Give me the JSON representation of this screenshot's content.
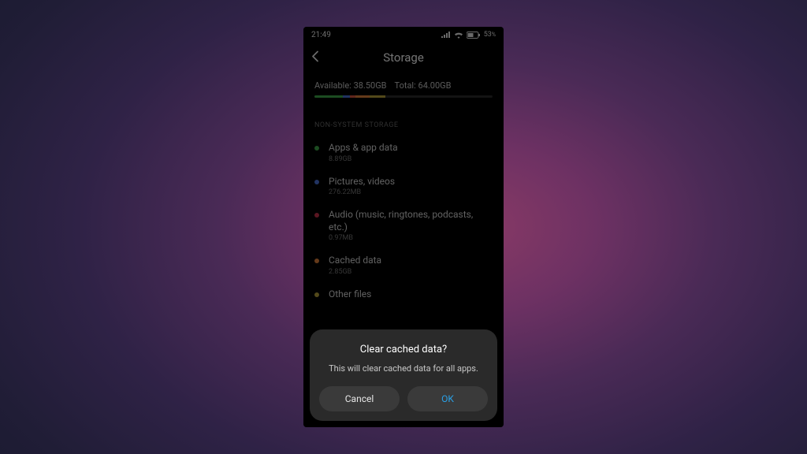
{
  "status": {
    "time": "21:49",
    "battery_text": "53"
  },
  "header": {
    "title": "Storage"
  },
  "summary": {
    "available_label": "Available:",
    "available_value": "38.50GB",
    "total_label": "Total:",
    "total_value": "64.00GB",
    "segments": [
      {
        "color": "#3fa84a",
        "pct": 16
      },
      {
        "color": "#4a72d8",
        "pct": 4
      },
      {
        "color": "#d8563f",
        "pct": 3
      },
      {
        "color": "#e0823a",
        "pct": 8
      },
      {
        "color": "#b8a23a",
        "pct": 9
      }
    ]
  },
  "section_label": "NON-SYSTEM STORAGE",
  "items": [
    {
      "dot": "#3fa84a",
      "title": "Apps & app data",
      "sub": "8.89GB"
    },
    {
      "dot": "#4a72d8",
      "title": "Pictures, videos",
      "sub": "276.22MB"
    },
    {
      "dot": "#c8324a",
      "title": "Audio (music, ringtones, podcasts, etc.)",
      "sub": "0.97MB"
    },
    {
      "dot": "#e0823a",
      "title": "Cached data",
      "sub": "2.85GB"
    },
    {
      "dot": "#b8a23a",
      "title": "Other files",
      "sub": ""
    }
  ],
  "dialog": {
    "title": "Clear cached data?",
    "message": "This will clear cached data for all apps.",
    "cancel": "Cancel",
    "ok": "OK"
  }
}
